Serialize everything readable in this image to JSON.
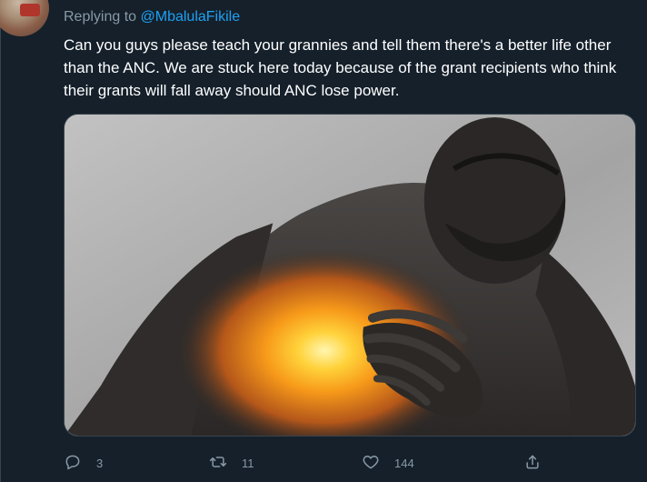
{
  "tweet": {
    "replying_prefix": "Replying to",
    "replying_handle": "@MbalulaFikile",
    "text": "Can you guys please teach your grannies and tell them there's a better life other than the ANC. We are stuck here today because of the grant recipients who think their grants will fall away should ANC lose power."
  },
  "media": {
    "icon": "photo-man-chest-pain"
  },
  "actions": {
    "reply_count": "3",
    "retweet_count": "11",
    "like_count": "144",
    "reply_icon": "reply-icon",
    "retweet_icon": "retweet-icon",
    "like_icon": "heart-icon",
    "share_icon": "share-icon"
  },
  "colors": {
    "background": "#15202b",
    "text": "#ffffff",
    "muted": "#8899a6",
    "link": "#1da1f2"
  }
}
